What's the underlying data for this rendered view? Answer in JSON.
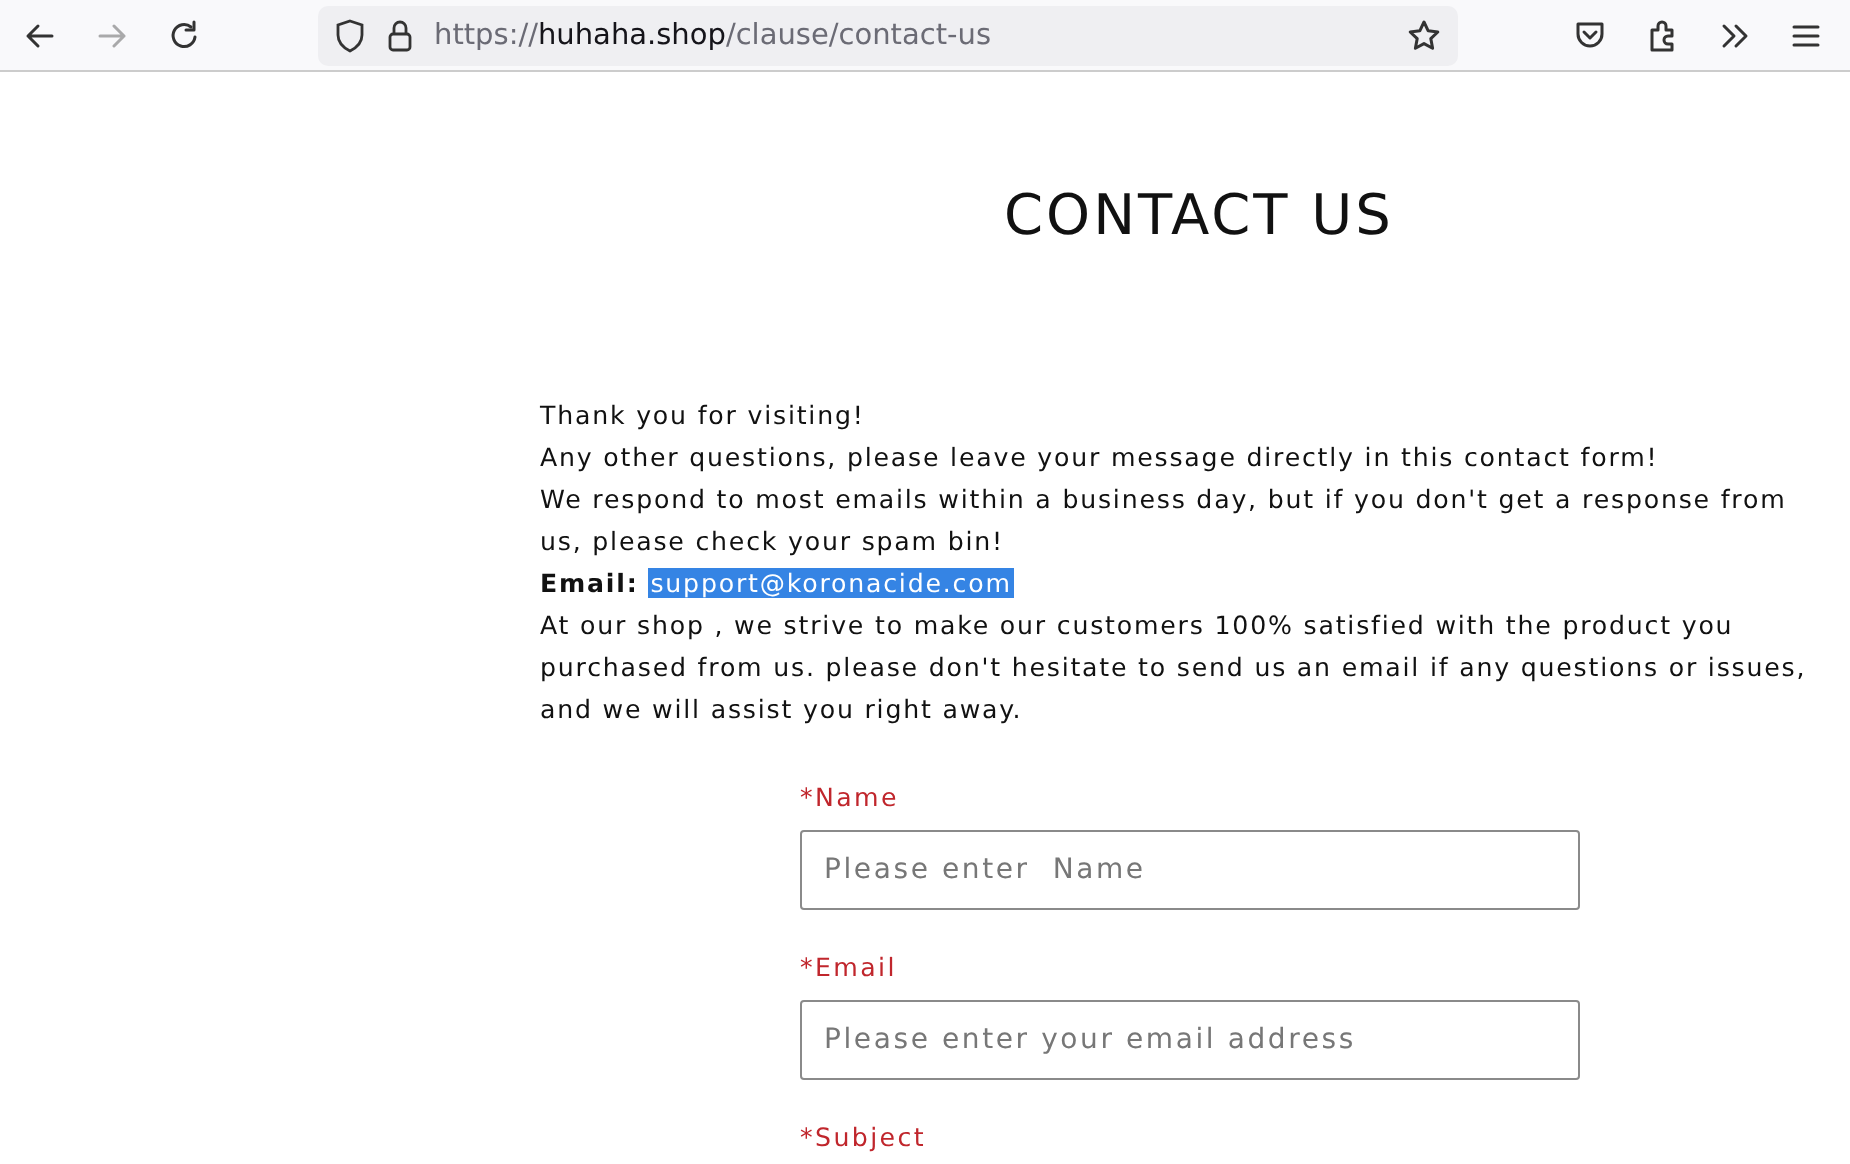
{
  "toolbar": {
    "url": {
      "scheme": "https://",
      "host": "huhaha.shop",
      "path": "/clause/contact-us"
    },
    "forward_disabled": true
  },
  "page": {
    "title": "CONTACT US",
    "paragraphs": [
      {
        "kind": "text",
        "text": "Thank you for visiting!"
      },
      {
        "kind": "text",
        "text": "Any other questions, please leave your message directly in this contact form!"
      },
      {
        "kind": "text",
        "text": "We respond to most emails within a business day, but if you don't get a response from us, please check your spam bin!"
      },
      {
        "kind": "email",
        "label": "Email:",
        "email": "support@koronacide.com",
        "selected": true
      },
      {
        "kind": "text",
        "text": "At our shop , we strive to make our customers 100% satisfied with the product you purchased from us. please don't hesitate to send us an email if any questions or issues, and we will assist you right away."
      }
    ],
    "form": [
      {
        "label": "*Name",
        "placeholder": "Please enter  Name"
      },
      {
        "label": "*Email",
        "placeholder": "Please enter your email address"
      },
      {
        "label": "*Subject"
      }
    ]
  }
}
